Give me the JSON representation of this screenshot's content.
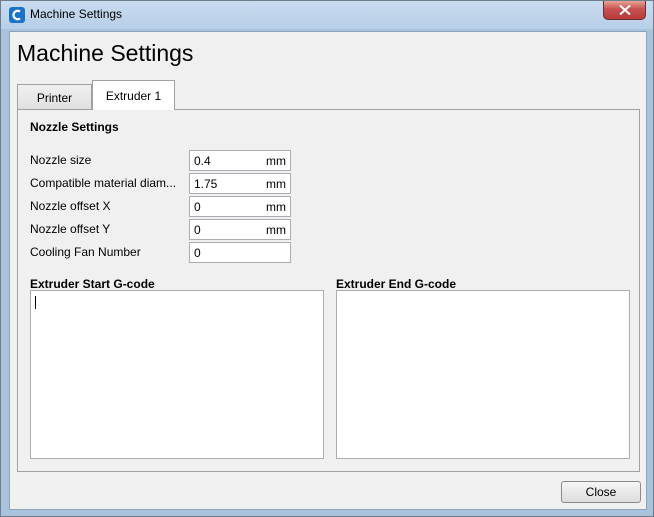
{
  "window": {
    "title": "Machine Settings",
    "heading": "Machine Settings",
    "app_icon": "cura-logo-icon",
    "close_icon": "close-icon"
  },
  "tabs": [
    {
      "label": "Printer",
      "active": false
    },
    {
      "label": "Extruder 1",
      "active": true
    }
  ],
  "nozzle_settings": {
    "title": "Nozzle Settings",
    "rows": [
      {
        "label": "Nozzle size",
        "value": "0.4",
        "unit": "mm"
      },
      {
        "label": "Compatible material diam...",
        "value": "1.75",
        "unit": "mm"
      },
      {
        "label": "Nozzle offset X",
        "value": "0",
        "unit": "mm"
      },
      {
        "label": "Nozzle offset Y",
        "value": "0",
        "unit": "mm"
      },
      {
        "label": "Cooling Fan Number",
        "value": "0",
        "unit": ""
      }
    ]
  },
  "gcode": {
    "start_label": "Extruder Start G-code",
    "start_value": "",
    "end_label": "Extruder End G-code",
    "end_value": ""
  },
  "footer": {
    "close_label": "Close"
  },
  "colors": {
    "titlebar": "#b7cfe8",
    "close_button": "#c75050",
    "panel_bg": "#f0f0f0"
  }
}
